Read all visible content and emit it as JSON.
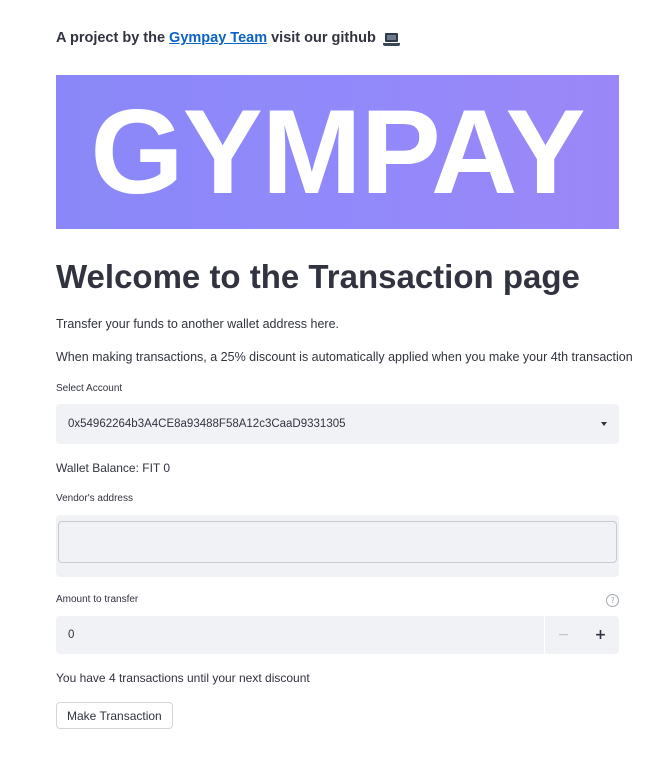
{
  "header": {
    "prefix": "A project by the",
    "team_link": "Gympay Team",
    "suffix": "visit our github",
    "icon": "laptop-icon"
  },
  "banner": {
    "text": "GYMPAY",
    "gradient_start": "#8a88f8",
    "gradient_end": "#9b87f7"
  },
  "main": {
    "title": "Welcome to the Transaction page",
    "intro": "Transfer your funds to another wallet address here.",
    "discount_note": "When making transactions, a 25% discount is automatically applied when you make your 4th transaction"
  },
  "account_select": {
    "label": "Select Account",
    "value": "0x54962264b3A4CE8a93488F58A12c3CaaD9331305"
  },
  "wallet": {
    "balance": "Wallet Balance: FIT 0"
  },
  "vendor": {
    "label": "Vendor's address",
    "value": "",
    "placeholder": ""
  },
  "amount": {
    "label": "Amount to transfer",
    "value": "0",
    "minus": "−",
    "plus": "+",
    "help": "?"
  },
  "status": {
    "remaining": "You have 4 transactions until your next discount"
  },
  "actions": {
    "submit": "Make Transaction"
  },
  "colors": {
    "link": "#0b63c6",
    "text": "#31333f",
    "input_bg": "#f0f2f6"
  }
}
